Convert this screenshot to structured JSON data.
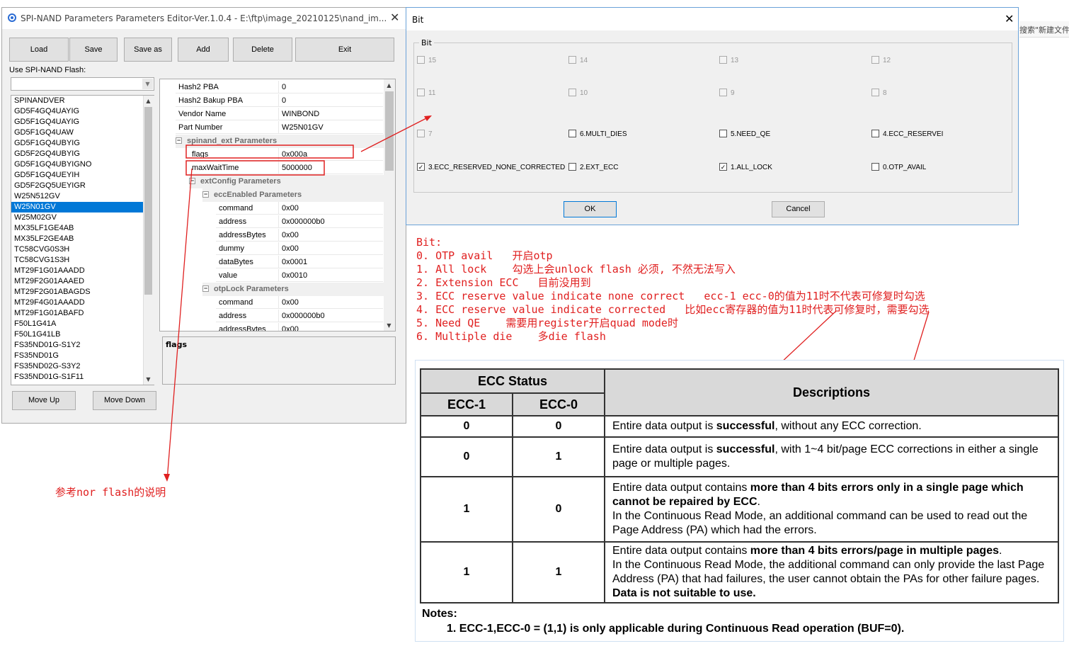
{
  "main_window": {
    "title": "SPI-NAND Parameters Parameters Editor-Ver.1.0.4 - E:\\ftp\\image_20210125\\nand_im...",
    "close": "✕",
    "toolbar": {
      "load": "Load",
      "save": "Save",
      "save_as": "Save as",
      "add": "Add",
      "delete": "Delete",
      "exit": "Exit"
    },
    "use_label": "Use SPI-NAND Flash:",
    "combo_value": "",
    "flash_list": [
      "SPINANDVER",
      "GD5F4GQ4UAYIG",
      "GD5F1GQ4UAYIG",
      "GD5F1GQ4UAW",
      "GD5F1GQ4UBYIG",
      "GD5F2GQ4UBYIG",
      "GD5F1GQ4UBYIGNO",
      "GD5F1GQ4UEYIH",
      "GD5F2GQ5UEYIGR",
      "W25N512GV",
      "W25N01GV",
      "W25M02GV",
      "MX35LF1GE4AB",
      "MX35LF2GE4AB",
      "TC58CVG0S3H",
      "TC58CVG1S3H",
      "MT29F1G01AAADD",
      "MT29F2G01AAAED",
      "MT29F2G01ABAGDS",
      "MT29F4G01AAADD",
      "MT29F1G01ABAFD",
      "F50L1G41A",
      "F50L1G41LB",
      "FS35ND01G-S1Y2",
      "FS35ND01G",
      "FS35ND02G-S3Y2",
      "FS35ND01G-S1F11"
    ],
    "selected_index": 10,
    "move_up": "Move Up",
    "move_down": "Move Down",
    "property_rows": [
      {
        "name": "Hash2 PBA",
        "value": "0"
      },
      {
        "name": "Hash2 Bakup PBA",
        "value": "0"
      },
      {
        "name": "Vendor Name",
        "value": "WINBOND"
      },
      {
        "name": "Part Number",
        "value": "W25N01GV"
      },
      {
        "category": "spinand_ext Parameters"
      },
      {
        "name": "flags",
        "value": "0x000a"
      },
      {
        "name": "maxWaitTime",
        "value": "5000000"
      },
      {
        "category": "extConfig Parameters"
      },
      {
        "category": "eccEnabled Parameters"
      },
      {
        "name": "command",
        "value": "0x00"
      },
      {
        "name": "address",
        "value": "0x000000b0"
      },
      {
        "name": "addressBytes",
        "value": "0x00"
      },
      {
        "name": "dummy",
        "value": "0x00"
      },
      {
        "name": "dataBytes",
        "value": "0x0001"
      },
      {
        "name": "value",
        "value": "0x0010"
      },
      {
        "category": "otpLock Parameters"
      },
      {
        "name": "command",
        "value": "0x00"
      },
      {
        "name": "address",
        "value": "0x000000b0"
      },
      {
        "name": "addressBytes",
        "value": "0x00"
      }
    ],
    "description_title": "flags"
  },
  "bit_dialog": {
    "title": "Bit",
    "close": "✕",
    "group_label": "Bit",
    "checkboxes": [
      {
        "label": "15",
        "checked": false,
        "enabled": false
      },
      {
        "label": "14",
        "checked": false,
        "enabled": false
      },
      {
        "label": "13",
        "checked": false,
        "enabled": false
      },
      {
        "label": "12",
        "checked": false,
        "enabled": false
      },
      {
        "label": "11",
        "checked": false,
        "enabled": false
      },
      {
        "label": "10",
        "checked": false,
        "enabled": false
      },
      {
        "label": "9",
        "checked": false,
        "enabled": false
      },
      {
        "label": "8",
        "checked": false,
        "enabled": false
      },
      {
        "label": "7",
        "checked": false,
        "enabled": false
      },
      {
        "label": "6.MULTI_DIES",
        "checked": false,
        "enabled": true
      },
      {
        "label": "5.NEED_QE",
        "checked": false,
        "enabled": true
      },
      {
        "label": "4.ECC_RESERVEI",
        "checked": false,
        "enabled": true
      },
      {
        "label": "3.ECC_RESERVED_NONE_CORRECTED",
        "checked": true,
        "enabled": true
      },
      {
        "label": "2.EXT_ECC",
        "checked": false,
        "enabled": true
      },
      {
        "label": "1.ALL_LOCK",
        "checked": true,
        "enabled": true
      },
      {
        "label": "0.OTP_AVAIL",
        "checked": false,
        "enabled": true
      }
    ],
    "ok": "OK",
    "cancel": "Cancel"
  },
  "annotations": {
    "bit_notes": [
      "Bit:",
      "0. OTP avail   开启otp",
      "1. All lock    勾选上会unlock flash 必须, 不然无法写入",
      "2. Extension ECC   目前没用到",
      "3. ECC reserve value indicate none correct   ecc-1 ecc-0的值为11时不代表可修复时勾选",
      "4. ECC reserve value indicate corrected   比如ecc寄存器的值为11时代表可修复时，需要勾选",
      "5. Need QE    需要用register开启quad mode时",
      "6. Multiple die    多die flash"
    ],
    "nor_note": "参考nor flash的说明"
  },
  "ecc_table": {
    "header_status": "ECC Status",
    "header_ecc1": "ECC-1",
    "header_ecc0": "ECC-0",
    "header_desc": "Descriptions",
    "rows": [
      {
        "ecc1": "0",
        "ecc0": "0",
        "parts": [
          [
            "Entire data output is ",
            false
          ],
          [
            "successful",
            true
          ],
          [
            ", without any ECC correction.",
            false
          ]
        ]
      },
      {
        "ecc1": "0",
        "ecc0": "1",
        "parts": [
          [
            "Entire data output is ",
            false
          ],
          [
            "successful",
            true
          ],
          [
            ", with 1~4 bit/page ECC corrections in either a single page or multiple pages.",
            false
          ]
        ]
      },
      {
        "ecc1": "1",
        "ecc0": "0",
        "parts": [
          [
            "Entire data output contains ",
            false
          ],
          [
            "more than 4 bits errors only in a single page which cannot be repaired by ECC",
            true
          ],
          [
            ".",
            false
          ],
          [
            "\nIn the Continuous Read Mode, an additional command can be used to read out the Page Address (PA) which had the errors.",
            false
          ]
        ]
      },
      {
        "ecc1": "1",
        "ecc0": "1",
        "parts": [
          [
            "Entire data output contains ",
            false
          ],
          [
            "more than 4 bits errors/page in multiple pages",
            true
          ],
          [
            ".",
            false
          ],
          [
            "\nIn the Continuous Read Mode, the additional command can only provide the last Page Address (PA) that had failures, the user cannot obtain the PAs for other failure pages. ",
            false
          ],
          [
            "Data is not suitable to use.",
            true
          ]
        ]
      }
    ],
    "notes_title": "Notes:",
    "notes_item": "1.    ECC-1,ECC-0 = (1,1) is only applicable during Continuous Read operation (BUF=0)."
  },
  "background_fragment": "搜索\"新建文件"
}
